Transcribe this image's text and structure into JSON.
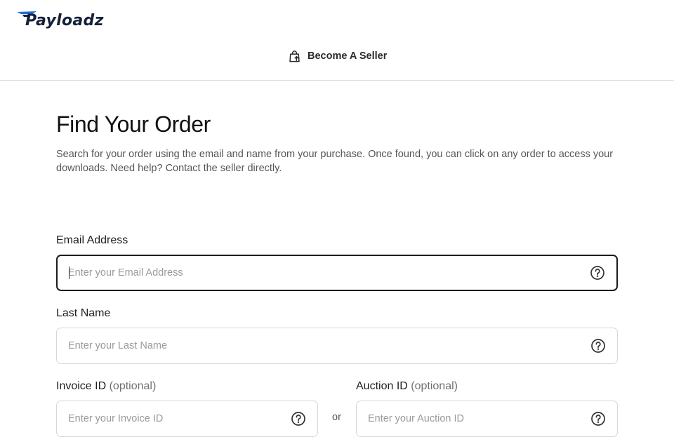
{
  "brand": {
    "name": "Payloadz",
    "color": "#15213a",
    "accent": "#1f6fd6"
  },
  "header": {
    "seller_link_label": "Become A Seller",
    "seller_icon": "shopping-bag-arrow-icon"
  },
  "page": {
    "title": "Find Your Order",
    "description": "Search for your order using the email and name from your purchase. Once found, you can click on any order to access your downloads. Need help? Contact the seller directly."
  },
  "form": {
    "email": {
      "label": "Email Address",
      "placeholder": "Enter your Email Address",
      "value": ""
    },
    "last_name": {
      "label": "Last Name",
      "placeholder": "Enter your Last Name",
      "value": ""
    },
    "invoice": {
      "label": "Invoice ID",
      "optional": "(optional)",
      "placeholder": "Enter your Invoice ID",
      "value": ""
    },
    "auction": {
      "label": "Auction ID",
      "optional": "(optional)",
      "placeholder": "Enter your Auction ID",
      "value": ""
    },
    "or_text": "or",
    "help_icon": "question-circle-icon"
  }
}
